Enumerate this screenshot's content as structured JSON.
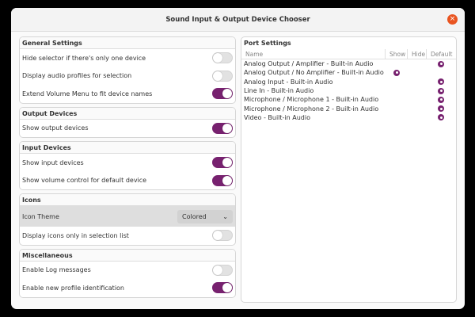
{
  "window": {
    "title": "Sound Input & Output Device Chooser"
  },
  "colors": {
    "accent": "#77216f",
    "close": "#e95420"
  },
  "sections": {
    "general": {
      "header": "General Settings",
      "rows": [
        {
          "label": "Hide selector if there's only one device",
          "on": false
        },
        {
          "label": "Display audio profiles for selection",
          "on": false
        },
        {
          "label": "Extend Volume Menu to fit device names",
          "on": true
        }
      ]
    },
    "output": {
      "header": "Output Devices",
      "rows": [
        {
          "label": "Show output devices",
          "on": true
        }
      ]
    },
    "input": {
      "header": "Input Devices",
      "rows": [
        {
          "label": "Show input devices",
          "on": true
        },
        {
          "label": "Show volume control for default device",
          "on": true
        }
      ]
    },
    "icons": {
      "header": "Icons",
      "theme_label": "Icon Theme",
      "theme_value": "Colored",
      "rows": [
        {
          "label": "Display icons only in selection list",
          "on": false
        }
      ]
    },
    "misc": {
      "header": "Miscellaneous",
      "rows": [
        {
          "label": "Enable Log messages",
          "on": false
        },
        {
          "label": "Enable new profile identification",
          "on": true
        }
      ]
    }
  },
  "ports": {
    "header": "Port Settings",
    "columns": [
      "Name",
      "Show",
      "Hide",
      "Default"
    ],
    "rows": [
      {
        "name": "Analog Output / Amplifier - Built-in Audio",
        "selected": "default"
      },
      {
        "name": "Analog Output / No Amplifier - Built-in Audio",
        "selected": "show"
      },
      {
        "name": "Analog Input - Built-in Audio",
        "selected": "default"
      },
      {
        "name": "Line In - Built-in Audio",
        "selected": "default"
      },
      {
        "name": "Microphone / Microphone 1 - Built-in Audio",
        "selected": "default"
      },
      {
        "name": "Microphone / Microphone 2 - Built-in Audio",
        "selected": "default"
      },
      {
        "name": "Video - Built-in Audio",
        "selected": "default"
      }
    ]
  }
}
